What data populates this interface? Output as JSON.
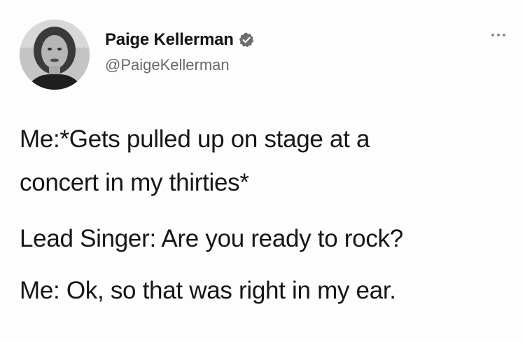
{
  "author": {
    "display_name": "Paige Kellerman",
    "handle": "@PaigeKellerman",
    "verified": true,
    "verified_icon": "verified-badge-icon",
    "avatar": "profile-photo"
  },
  "menu": {
    "icon": "more-options-icon"
  },
  "tweet": {
    "lines": [
      "Me:*Gets pulled up on stage at a",
      "concert in my thirties*",
      "Lead Singer: Are you ready to rock?",
      "Me: Ok, so that was right in my ear."
    ]
  },
  "colors": {
    "verified_badge": "#6d6d6d",
    "text": "#161616",
    "handle": "#6a6a6a"
  }
}
